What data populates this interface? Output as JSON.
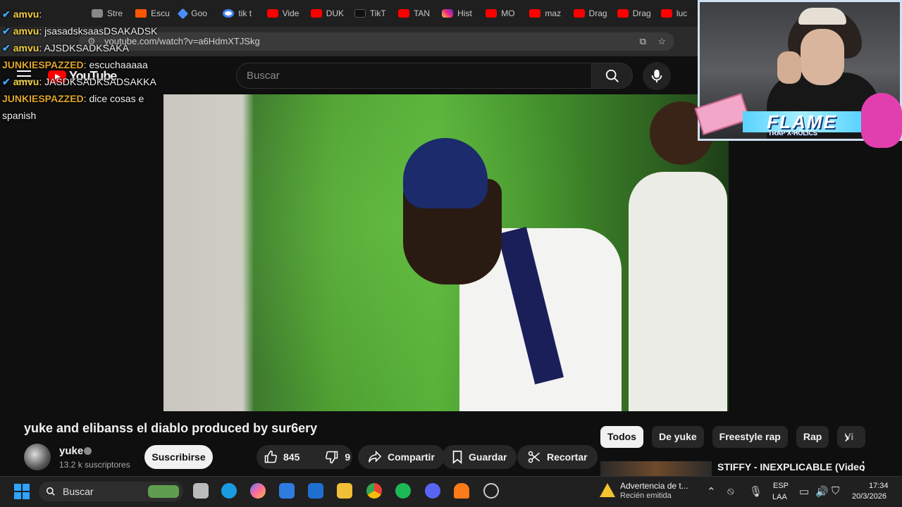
{
  "browser": {
    "tabs": [
      {
        "label": "Stre",
        "icon": "tab-icon"
      },
      {
        "label": "Escu",
        "icon": "soundcloud-icon"
      },
      {
        "label": "Goo",
        "icon": "gemini-icon"
      },
      {
        "label": "tik t",
        "icon": "google-icon"
      },
      {
        "label": "Vide",
        "icon": "youtube-icon"
      },
      {
        "label": "DUK",
        "icon": "youtube-icon"
      },
      {
        "label": "TikT",
        "icon": "tiktok-icon"
      },
      {
        "label": "TAN",
        "icon": "youtube-icon"
      },
      {
        "label": "Hist",
        "icon": "instagram-icon"
      },
      {
        "label": "MO",
        "icon": "youtube-icon"
      },
      {
        "label": "maz",
        "icon": "youtube-icon"
      },
      {
        "label": "Drag",
        "icon": "youtube-icon"
      },
      {
        "label": "Drag",
        "icon": "youtube-icon"
      },
      {
        "label": "luc",
        "icon": "youtube-icon"
      }
    ],
    "url": "youtube.com/watch?v=a6HdmXTJSkg"
  },
  "chat": [
    {
      "user": "amvu",
      "color": "#f5d142",
      "text": "",
      "mod": true
    },
    {
      "user": "amvu",
      "color": "#f5d142",
      "text": "jsasadsksaasDSAKADSK",
      "mod": true
    },
    {
      "user": "amvu",
      "color": "#f5d142",
      "text": "AJSDKSADKSAKA",
      "mod": true
    },
    {
      "user": "JUNKIESPAZZED",
      "color": "#e0a52a",
      "text": "escuchaaaaa",
      "mod": false
    },
    {
      "user": "amvu",
      "color": "#f5d142",
      "text": "JASDKSADKSADSAKKA",
      "mod": true
    },
    {
      "user": "JUNKIESPAZZED",
      "color": "#e0a52a",
      "text": "dice cosas e spanish",
      "mod": false
    }
  ],
  "youtube": {
    "logo": "YouTube",
    "search_placeholder": "Buscar",
    "video_title": "yuke and elibanss el diablo produced by sur6ery",
    "channel_name": "yuke",
    "subscribers": "13.2 k suscriptores",
    "subscribe_label": "Suscribirse",
    "likes": "845",
    "dislikes": "9",
    "share_label": "Compartir",
    "save_label": "Guardar",
    "clip_label": "Recortar",
    "chips": [
      "Todos",
      "De yuke",
      "Freestyle rap",
      "Rap",
      "Vi"
    ],
    "recommendation_title": "STIFFY - INEXPLICABLE (Video"
  },
  "overlay": {
    "banner_text": "FLAME",
    "banner_sub": "TRAP X-HOLICS"
  },
  "taskbar": {
    "search_label": "Buscar",
    "notification_title": "Advertencia de t...",
    "notification_sub": "Recién emitida",
    "lang_top": "ESP",
    "lang_bottom": "LAA",
    "time": "17:34",
    "date": "20/3/2026"
  },
  "colors": {
    "accent": "#ff0000",
    "background": "#0f0f0f",
    "mod_badge": "#3ea6ff"
  }
}
